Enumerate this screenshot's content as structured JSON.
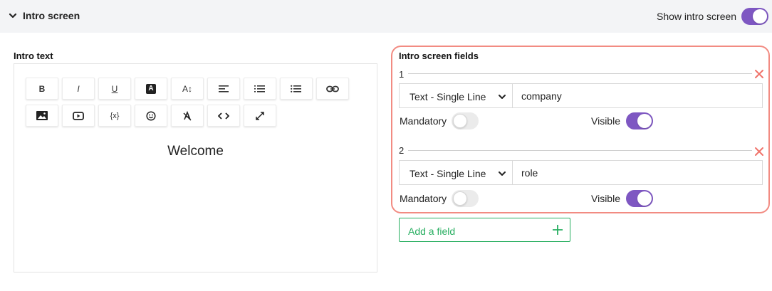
{
  "header": {
    "title": "Intro screen",
    "show_toggle_label": "Show intro screen",
    "show_toggle_on": true
  },
  "intro_text": {
    "label": "Intro text",
    "toolbar_row1": [
      "B",
      "I",
      "U",
      "A",
      "A↕",
      "align-left",
      "ordered-list",
      "unordered-list",
      "link"
    ],
    "toolbar_row2": [
      "image",
      "video",
      "{x}",
      "emoji",
      "clear-format",
      "code",
      "expand"
    ],
    "content": "Welcome"
  },
  "fields_section": {
    "label": "Intro screen fields",
    "fields": [
      {
        "number": "1",
        "type": "Text - Single Line",
        "value": "company",
        "mandatory_label": "Mandatory",
        "mandatory": false,
        "visible_label": "Visible",
        "visible": true
      },
      {
        "number": "2",
        "type": "Text - Single Line",
        "value": "role",
        "mandatory_label": "Mandatory",
        "mandatory": false,
        "visible_label": "Visible",
        "visible": true
      }
    ]
  },
  "add_field": {
    "label": "Add a field"
  },
  "colors": {
    "accent": "#7e57c2",
    "highlight": "#f28b82",
    "add": "#27ae60",
    "remove": "#f0736a"
  }
}
